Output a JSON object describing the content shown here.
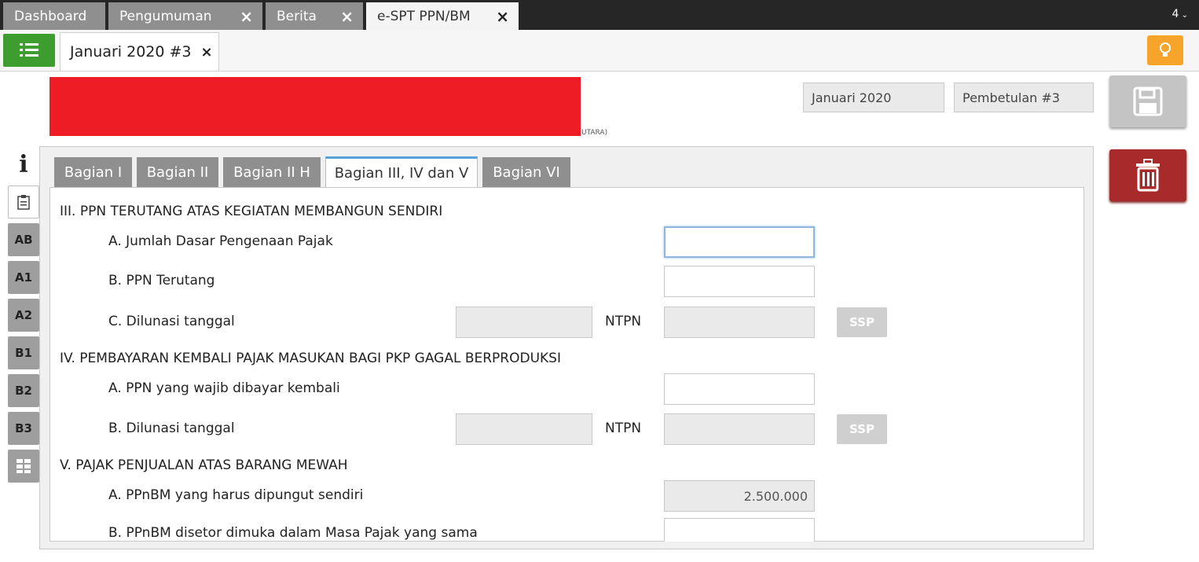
{
  "topbar": {
    "tabs": [
      {
        "label": "Dashboard"
      },
      {
        "label": "Pengumuman"
      },
      {
        "label": "Berita"
      },
      {
        "label": "e-SPT PPN/BM"
      }
    ],
    "tab_count": "4"
  },
  "doc_tab": {
    "label": "Januari 2020 #3"
  },
  "header": {
    "address_fragment": "UTARA)",
    "period": "Januari 2020",
    "revision": "Pembetulan #3"
  },
  "sidebar": {
    "items": [
      "i",
      "",
      "AB",
      "A1",
      "A2",
      "B1",
      "B2",
      "B3",
      ""
    ]
  },
  "tabs": [
    "Bagian I",
    "Bagian II",
    "Bagian II H",
    "Bagian III, IV dan V",
    "Bagian VI"
  ],
  "form": {
    "sec3": {
      "title": "III. PPN TERUTANG ATAS KEGIATAN MEMBANGUN SENDIRI",
      "a_label": "A. Jumlah Dasar Pengenaan Pajak",
      "b_label": "B. PPN Terutang",
      "c_label": "C. Dilunasi tanggal"
    },
    "sec4": {
      "title": "IV. PEMBAYARAN KEMBALI PAJAK MASUKAN BAGI PKP GAGAL BERPRODUKSI",
      "a_label": "A. PPN yang wajib dibayar kembali",
      "b_label": "B. Dilunasi tanggal"
    },
    "sec5": {
      "title": "V. PAJAK PENJUALAN ATAS BARANG MEWAH",
      "a_label": "A. PPnBM yang harus dipungut sendiri",
      "a_value": "2.500.000",
      "b_label": "B. PPnBM disetor dimuka dalam Masa Pajak yang sama"
    },
    "ntpn_label": "NTPN",
    "ssp_label": "SSP"
  },
  "colors": {
    "green": "#3d9e2f",
    "orange": "#f6a42a",
    "danger": "#a92a2a",
    "redaction": "#ee1c24"
  }
}
